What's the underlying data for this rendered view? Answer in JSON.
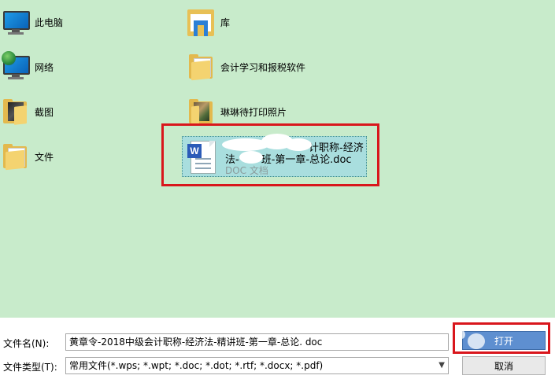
{
  "browser": {
    "items": [
      {
        "label": "此电脑",
        "icon": "computer-icon"
      },
      {
        "label": "网络",
        "icon": "network-icon"
      },
      {
        "label": "截图",
        "icon": "folder-icon"
      },
      {
        "label": "文件",
        "icon": "folder-icon"
      },
      {
        "label": "库",
        "icon": "library-icon"
      },
      {
        "label": "会计学习和报税软件",
        "icon": "folder-icon"
      },
      {
        "label": "琳琳待打印照片",
        "icon": "photo-folder-icon"
      }
    ],
    "selected_file": {
      "name_line1": "计职称-经济",
      "name_line2_a": "法-",
      "name_line2_b": "班-第一章-总论.doc",
      "type": "DOC 文档",
      "icon": "word-doc-icon"
    }
  },
  "bottom": {
    "filename_label": "文件名(N):",
    "filename_value": "黄章令-2018中级会计职称-经济法-精讲班-第一章-总论. doc",
    "filetype_label": "文件类型(T):",
    "filetype_value": "常用文件(*.wps; *.wpt; *.doc; *.dot; *.rtf; *.docx; *.pdf)",
    "open_button": "打开",
    "cancel_button": "取消"
  },
  "colors": {
    "browser_bg": "#c8ebcb",
    "selection_bg": "#a9dede",
    "highlight_box": "#d9161c",
    "open_button_bg": "#5e8fd0"
  }
}
